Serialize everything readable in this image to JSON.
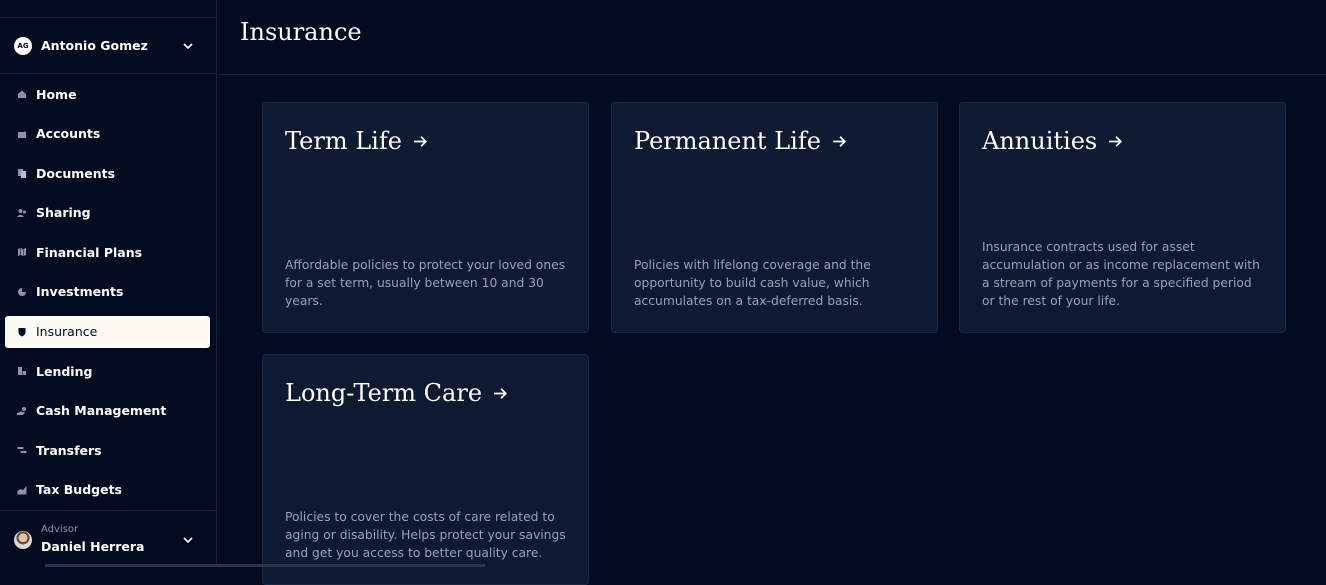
{
  "user": {
    "initials": "AG",
    "name": "Antonio Gomez"
  },
  "nav": [
    {
      "label": "Home",
      "icon": "home-icon"
    },
    {
      "label": "Accounts",
      "icon": "wallet-icon"
    },
    {
      "label": "Documents",
      "icon": "documents-icon"
    },
    {
      "label": "Sharing",
      "icon": "people-icon"
    },
    {
      "label": "Financial Plans",
      "icon": "map-icon"
    },
    {
      "label": "Investments",
      "icon": "pie-chart-icon"
    },
    {
      "label": "Insurance",
      "icon": "shield-icon",
      "active": true
    },
    {
      "label": "Lending",
      "icon": "building-icon"
    },
    {
      "label": "Cash Management",
      "icon": "hand-coin-icon"
    },
    {
      "label": "Transfers",
      "icon": "transfer-icon"
    },
    {
      "label": "Tax Budgets",
      "icon": "chart-up-icon"
    }
  ],
  "advisor": {
    "caption": "Advisor",
    "name": "Daniel Herrera"
  },
  "page": {
    "title": "Insurance"
  },
  "cards": [
    {
      "title": "Term Life",
      "description": "Affordable policies to protect your loved ones for a set term, usually between 10 and 30 years."
    },
    {
      "title": "Permanent Life",
      "description": "Policies with lifelong coverage and the opportunity to build cash value, which accumulates on a tax-deferred basis."
    },
    {
      "title": "Annuities",
      "description": "Insurance contracts used for asset accumulation or as income replacement with a stream of payments for a specified period or the rest of your life."
    },
    {
      "title": "Long-Term Care",
      "description": "Policies to cover the costs of care related to aging or disability. Helps protect your savings and get you access to better quality care."
    }
  ],
  "colors": {
    "background": "#020b1f",
    "card": "#0e1a31",
    "active_nav": "#fcfcf2",
    "muted_text": "#98a0b3"
  }
}
